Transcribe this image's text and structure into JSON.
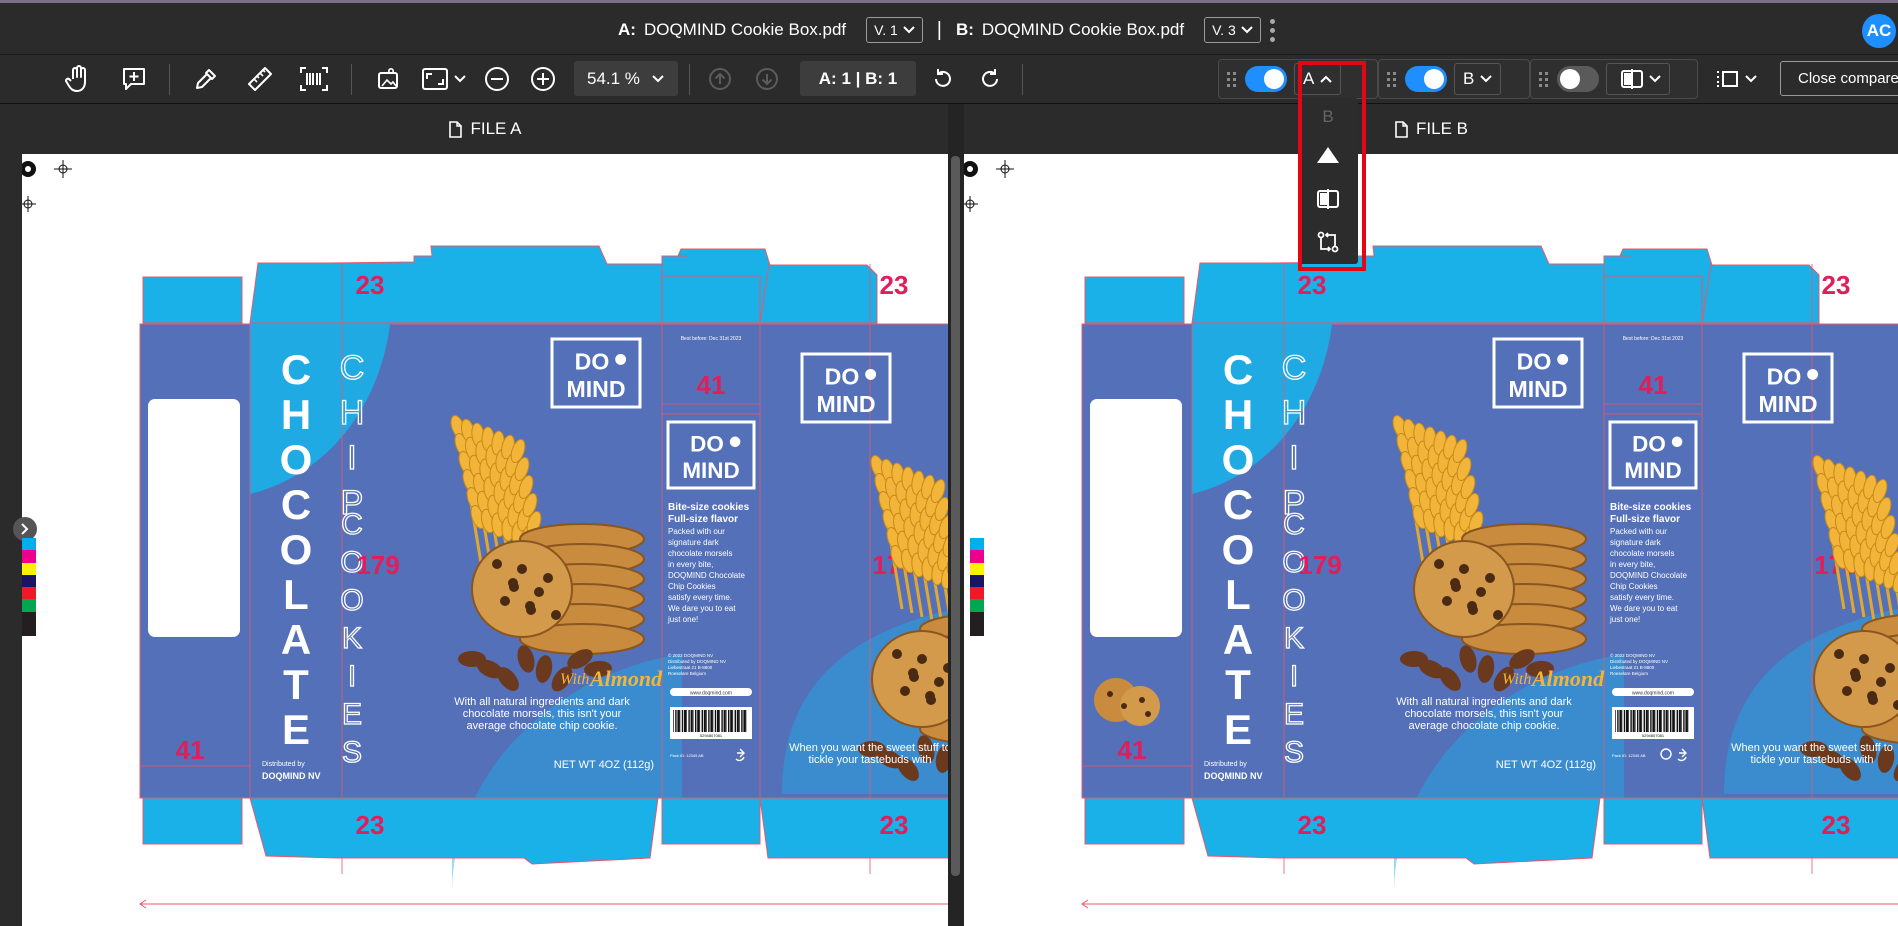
{
  "top": {
    "file_a_label": "A:",
    "file_a_name": "DOQMIND Cookie Box.pdf",
    "file_a_version": "V. 1",
    "divider": "|",
    "file_b_label": "B:",
    "file_b_name": "DOQMIND Cookie Box.pdf",
    "file_b_version": "V. 3",
    "avatar": "AC"
  },
  "toolbar": {
    "zoom": "54.1 %",
    "pages": "A: 1 | B: 1",
    "layer_a": "A",
    "layer_b": "B",
    "close": "Close compare",
    "accent": "#1e8fff"
  },
  "popup": {
    "title": "B",
    "items": [
      "triangle-icon",
      "swap-sides-icon",
      "swap-arrows-icon"
    ]
  },
  "panels": {
    "a": {
      "title": "FILE A"
    },
    "b": {
      "title": "FILE B"
    }
  },
  "artwork": {
    "dim_top": "23",
    "dim_side_flap": "41",
    "dim_height": "179",
    "dim_bottom": "23",
    "logo_line1": "DO",
    "logo_line2": "MIND",
    "word_chocolate": "CHOCOLATE",
    "word_chip": "CHIP",
    "word_cookies": "COOKIES",
    "best_before": "Best before: Dec 31st 2023",
    "bite_title": "Bite-size cookies",
    "bite_sub": "Full-size flavor",
    "bite_body": "Packed with our signature dark chocolate morsels in every bite, DOQMIND Chocolate Chip Cookies satisfy every time. We dare you to eat just one!",
    "with_almond_with": "With",
    "with_almond": "Almond",
    "tagline": "With all natural ingredients and dark chocolate morsels, this isn't your average chocolate chip cookie.",
    "net_wt": "NET WT 4OZ (112g)",
    "distributed_by": "Distributed by",
    "distributor": "DOQMIND NV",
    "copyright": "© 2022 DOQMIND NV Distributed by DOQMIND NV Liebestraat 21 B-8800 Roeselare Belgium",
    "website": "www.doqmind.com",
    "barcode_number": "5294807081",
    "pack_id": "Pack ID: 12345 AB",
    "right_tag": "When you want the sweet stuff to tickle your tastebuds with"
  },
  "swatch_colors": [
    "#00aeef",
    "#ec008c",
    "#fff200",
    "#1b1464",
    "#ed1c24",
    "#00a651",
    "#231f20",
    "#231f20"
  ]
}
